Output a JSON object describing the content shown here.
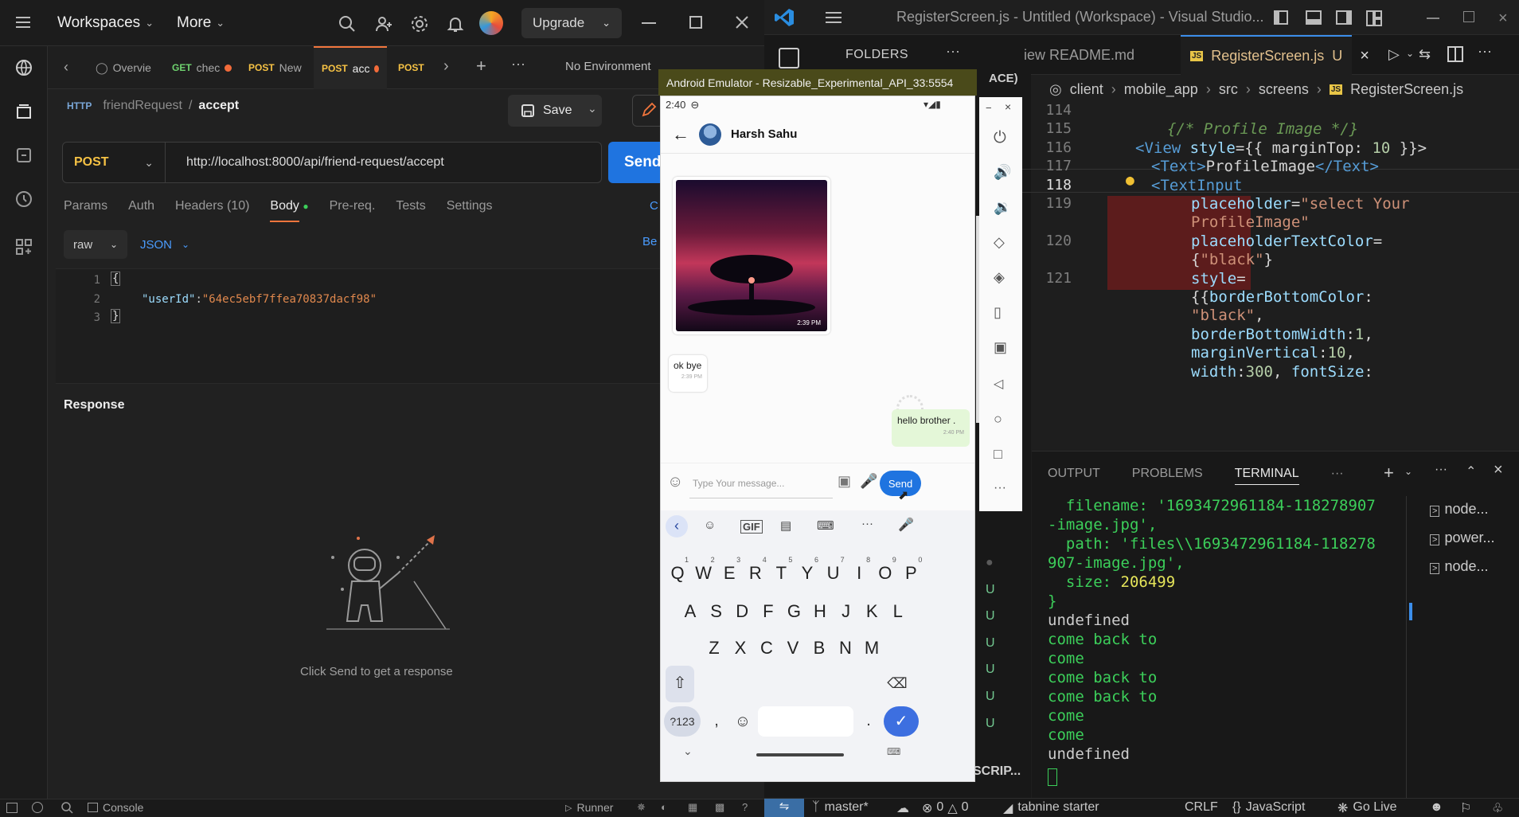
{
  "postman": {
    "menu": {
      "workspaces": "Workspaces",
      "more": "More",
      "upgrade": "Upgrade"
    },
    "tabs": [
      {
        "label": "Overvie"
      },
      {
        "method": "GET",
        "label": "chec"
      },
      {
        "method": "POST",
        "label": "New"
      },
      {
        "method": "POST",
        "label": "acc"
      },
      {
        "method": "POST",
        "label": ""
      }
    ],
    "environment": "No Environment",
    "breadcrumb": {
      "collection": "friendRequest",
      "separator": "/",
      "request": "accept"
    },
    "save_label": "Save",
    "method": "POST",
    "url": "http://localhost:8000/api/friend-request/accept",
    "send_label": "Send",
    "request_tabs": [
      "Params",
      "Auth",
      "Headers (10)",
      "Body",
      "Pre-req.",
      "Tests",
      "Settings"
    ],
    "cookies_short": "C",
    "beautify_short": "Be",
    "body_mode": "raw",
    "body_format": "JSON",
    "code_lines": [
      {
        "n": "1",
        "text": "{"
      },
      {
        "n": "2",
        "key": "\"userId\"",
        "colon": ":",
        "value": "\"64ec5ebf7ffea70837dacf98\""
      },
      {
        "n": "3",
        "text": "}"
      }
    ],
    "response_label": "Response",
    "empty_hint": "Click Send to get a response",
    "status": {
      "console": "Console",
      "runner": "Runner"
    }
  },
  "vscode": {
    "title": "RegisterScreen.js - Untitled (Workspace) - Visual Studio...",
    "folders": "FOLDERS",
    "tabs": {
      "readme": "iew README.md",
      "active": "RegisterScreen.js",
      "active_badge": "U"
    },
    "breadcrumb": [
      "client",
      "mobile_app",
      "src",
      "screens",
      "RegisterScreen.js"
    ],
    "explorer_partial": "ACE)",
    "scripts_partial": "SCRIP...",
    "file_badges": [
      "U",
      "U",
      "U",
      "U",
      "U",
      "U"
    ],
    "code": [
      {
        "n": "114",
        "segments": []
      },
      {
        "n": "115",
        "segments": [
          {
            "t": "{/* Profile Image */}",
            "c": "cmt"
          }
        ]
      },
      {
        "n": "116",
        "segments": [
          {
            "t": "<View ",
            "c": "tag"
          },
          {
            "t": "style",
            "c": "att"
          },
          {
            "t": "={{ marginTop: ",
            "c": "pl"
          },
          {
            "t": "10",
            "c": "num"
          },
          {
            "t": " }}>",
            "c": "pl"
          }
        ]
      },
      {
        "n": "117",
        "segments": [
          {
            "t": "<Text>",
            "c": "tag"
          },
          {
            "t": "ProfileImage",
            "c": "pl"
          },
          {
            "t": "</Text>",
            "c": "tag"
          }
        ]
      },
      {
        "n": "118",
        "segments": [
          {
            "t": "<TextInput",
            "c": "tag"
          }
        ]
      },
      {
        "n": "119",
        "segments": [
          {
            "t": "placeholder",
            "c": "att"
          },
          {
            "t": "=",
            "c": "pl"
          },
          {
            "t": "\"select Your",
            "c": "str"
          }
        ]
      },
      {
        "n": "",
        "segments": [
          {
            "t": "ProfileImage\"",
            "c": "str"
          }
        ]
      },
      {
        "n": "120",
        "segments": [
          {
            "t": "placeholderTextColor",
            "c": "att"
          },
          {
            "t": "=",
            "c": "pl"
          }
        ]
      },
      {
        "n": "",
        "segments": [
          {
            "t": "{",
            "c": "pl"
          },
          {
            "t": "\"black\"",
            "c": "str"
          },
          {
            "t": "}",
            "c": "pl"
          }
        ]
      },
      {
        "n": "121",
        "segments": [
          {
            "t": "style",
            "c": "att"
          },
          {
            "t": "=",
            "c": "pl"
          }
        ]
      },
      {
        "n": "",
        "segments": [
          {
            "t": "{{",
            "c": "pl"
          },
          {
            "t": "borderBottomColor",
            "c": "att"
          },
          {
            "t": ":",
            "c": "pl"
          }
        ]
      },
      {
        "n": "",
        "segments": [
          {
            "t": "\"black\"",
            "c": "str"
          },
          {
            "t": ",",
            "c": "pl"
          }
        ]
      },
      {
        "n": "",
        "segments": [
          {
            "t": "borderBottomWidth",
            "c": "att"
          },
          {
            "t": ":",
            "c": "pl"
          },
          {
            "t": "1",
            "c": "num"
          },
          {
            "t": ",",
            "c": "pl"
          }
        ]
      },
      {
        "n": "",
        "segments": [
          {
            "t": "marginVertical",
            "c": "att"
          },
          {
            "t": ":",
            "c": "pl"
          },
          {
            "t": "10",
            "c": "num"
          },
          {
            "t": ",",
            "c": "pl"
          }
        ]
      },
      {
        "n": "",
        "segments": [
          {
            "t": "width",
            "c": "att"
          },
          {
            "t": ":",
            "c": "pl"
          },
          {
            "t": "300",
            "c": "num"
          },
          {
            "t": ", ",
            "c": "pl"
          },
          {
            "t": "fontSize",
            "c": "att"
          },
          {
            "t": ":",
            "c": "pl"
          }
        ]
      }
    ],
    "panel_tabs": [
      "OUTPUT",
      "PROBLEMS",
      "TERMINAL",
      "···"
    ],
    "terminal": [
      {
        "t": "  filename: '1693472961184-118278907",
        "c": "g"
      },
      {
        "t": "-image.jpg',",
        "c": "g"
      },
      {
        "t": "  path: 'files\\\\1693472961184-118278",
        "c": "g"
      },
      {
        "t": "907-image.jpg',",
        "c": "g"
      },
      {
        "t": "  size: ",
        "c": "g",
        "y": "206499"
      },
      {
        "t": "}",
        "c": "g"
      },
      {
        "t": "undefined",
        "c": "w"
      },
      {
        "t": "come back to",
        "c": "g"
      },
      {
        "t": "come",
        "c": "g"
      },
      {
        "t": "come back to",
        "c": "g"
      },
      {
        "t": "come back to",
        "c": "g"
      },
      {
        "t": "come",
        "c": "g"
      },
      {
        "t": "come",
        "c": "g"
      },
      {
        "t": "undefined",
        "c": "w"
      }
    ],
    "terminal_list": [
      "node...",
      "power...",
      "node..."
    ],
    "status": {
      "branch": "master*",
      "errors": "0",
      "warnings": "0",
      "tabnine": "tabnine starter",
      "eol": "CRLF",
      "language": "JavaScript",
      "golive": "Go Live"
    }
  },
  "emulator": {
    "title": "Android Emulator - Resizable_Experimental_API_33:5554",
    "time": "2:40",
    "contact": "Harsh Sahu",
    "image_time": "2:39 PM",
    "msg_received": "ok bye",
    "msg_received_time": "2:39 PM",
    "msg_sent": "hello brother .",
    "msg_sent_time": "2:40 PM",
    "input_placeholder": "Type Your message...",
    "send_label": "Send",
    "kbd_row1": [
      [
        "Q",
        "1"
      ],
      [
        "W",
        "2"
      ],
      [
        "E",
        "3"
      ],
      [
        "R",
        "4"
      ],
      [
        "T",
        "5"
      ],
      [
        "Y",
        "6"
      ],
      [
        "U",
        "7"
      ],
      [
        "I",
        "8"
      ],
      [
        "O",
        "9"
      ],
      [
        "P",
        "0"
      ]
    ],
    "kbd_row2": [
      "A",
      "S",
      "D",
      "F",
      "G",
      "H",
      "J",
      "K",
      "L"
    ],
    "kbd_row3": [
      "Z",
      "X",
      "C",
      "V",
      "B",
      "N",
      "M"
    ],
    "kbd_sym": "?123",
    "kbd_comma": ",",
    "kbd_period": ".",
    "kbd_gif": "GIF"
  }
}
